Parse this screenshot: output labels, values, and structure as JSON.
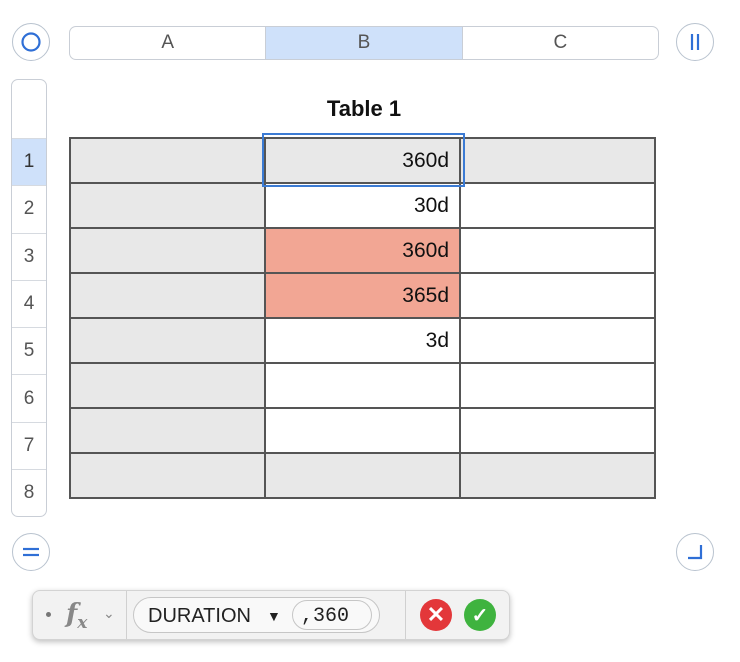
{
  "table": {
    "title": "Table 1",
    "column_headers": [
      "A",
      "B",
      "C"
    ],
    "row_headers": [
      "1",
      "2",
      "3",
      "4",
      "5",
      "6",
      "7",
      "8"
    ],
    "selected_column": "B",
    "selected_row": "1",
    "highlight_color": "#f2a694",
    "header_cell_color": "#e8e8e8",
    "selection_color": "#3b7bd4",
    "cells": {
      "b1": "360d",
      "b2": "30d",
      "b3": "360d",
      "b4": "365d",
      "b5": "3d"
    }
  },
  "handles": {
    "select_table_icon": "circle-icon",
    "add_columns_icon": "column-handle-icon",
    "add_rows_icon": "row-handle-icon",
    "resize_icon": "resize-corner-icon"
  },
  "formula_bar": {
    "fx_label": "f",
    "fx_sub": "x",
    "function_name": "DURATION",
    "argument": ",360",
    "cancel_symbol": "✕",
    "accept_symbol": "✓"
  }
}
